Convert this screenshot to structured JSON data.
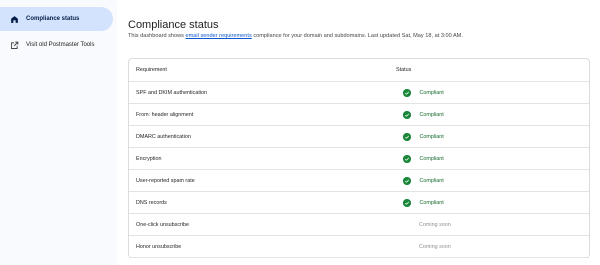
{
  "sidebar": {
    "items": [
      {
        "label": "Compliance status",
        "icon": "home-icon",
        "active": true
      },
      {
        "label": "Visit old Postmaster Tools",
        "icon": "open-in-new-icon",
        "active": false
      }
    ]
  },
  "header": {
    "title": "Compliance status",
    "subtitle_pre": "This dashboard shows ",
    "subtitle_link": "email sender requirements",
    "subtitle_post": " compliance for your domain and subdomains. Last updated Sat, May 18, at 3:00 AM."
  },
  "table": {
    "columns": [
      "Requirement",
      "Status"
    ],
    "rows": [
      {
        "requirement": "SPF and DKIM authentication",
        "status": "Compliant"
      },
      {
        "requirement": "From: header alignment",
        "status": "Compliant"
      },
      {
        "requirement": "DMARC authentication",
        "status": "Compliant"
      },
      {
        "requirement": "Encryption",
        "status": "Compliant"
      },
      {
        "requirement": "User-reported spam rate",
        "status": "Compliant"
      },
      {
        "requirement": "DNS records",
        "status": "Compliant"
      },
      {
        "requirement": "One-click unsubscribe",
        "status": "Coming soon"
      },
      {
        "requirement": "Honor unsubscribe",
        "status": "Coming soon"
      }
    ]
  },
  "colors": {
    "active_nav_bg": "#d3e3fd",
    "compliant_green": "#198639",
    "link_blue": "#0b57d0"
  }
}
